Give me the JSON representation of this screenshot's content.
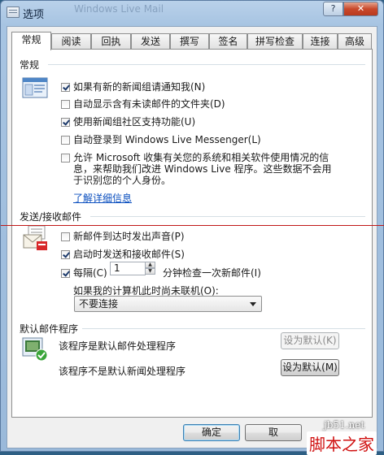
{
  "window": {
    "title": "选项",
    "background_title": "Windows Live Mail",
    "help_label": "?",
    "close_label": "✕"
  },
  "tabs": [
    {
      "label": "常规",
      "active": true
    },
    {
      "label": "阅读"
    },
    {
      "label": "回执"
    },
    {
      "label": "发送"
    },
    {
      "label": "撰写"
    },
    {
      "label": "签名"
    },
    {
      "label": "拼写检查"
    },
    {
      "label": "连接"
    },
    {
      "label": "高级"
    }
  ],
  "general": {
    "heading": "常规",
    "options": [
      {
        "label": "如果有新的新闻组请通知我(N)",
        "checked": true
      },
      {
        "label": "自动显示含有未读邮件的文件夹(D)",
        "checked": false
      },
      {
        "label": "使用新闻组社区支持功能(U)",
        "checked": true
      },
      {
        "label": "自动登录到 Windows Live Messenger(L)",
        "checked": false
      },
      {
        "label_lines": [
          "允许 Microsoft 收集有关您的系统和相关软件使用情况的信",
          "息，来帮助我们改进 Windows Live 程序。这些数据不会用",
          "于识别您的个人身份。"
        ],
        "checked": false
      }
    ],
    "learn_more": "了解详细信息"
  },
  "send_receive": {
    "heading": "发送/接收邮件",
    "play_sound": {
      "label": "新邮件到达时发出声音(P)",
      "checked": false
    },
    "send_on_start": {
      "label": "启动时发送和接收邮件(S)",
      "checked": true
    },
    "check_every": {
      "label": "每隔(C)",
      "checked": true,
      "value": "1",
      "suffix": "分钟检查一次新邮件(I)"
    },
    "offline_label": "如果我的计算机此时尚未联机(O):",
    "offline_select": "不要连接"
  },
  "default_programs": {
    "heading": "默认邮件程序",
    "mail_text": "该程序是默认邮件处理程序",
    "mail_button": "设为默认(K)",
    "news_text": "该程序不是默认新闻处理程序",
    "news_button": "设为默认(M)"
  },
  "footer": {
    "ok": "确定",
    "cancel": "取"
  },
  "watermark": {
    "site": "jb51.net",
    "brand": "脚本之家"
  }
}
